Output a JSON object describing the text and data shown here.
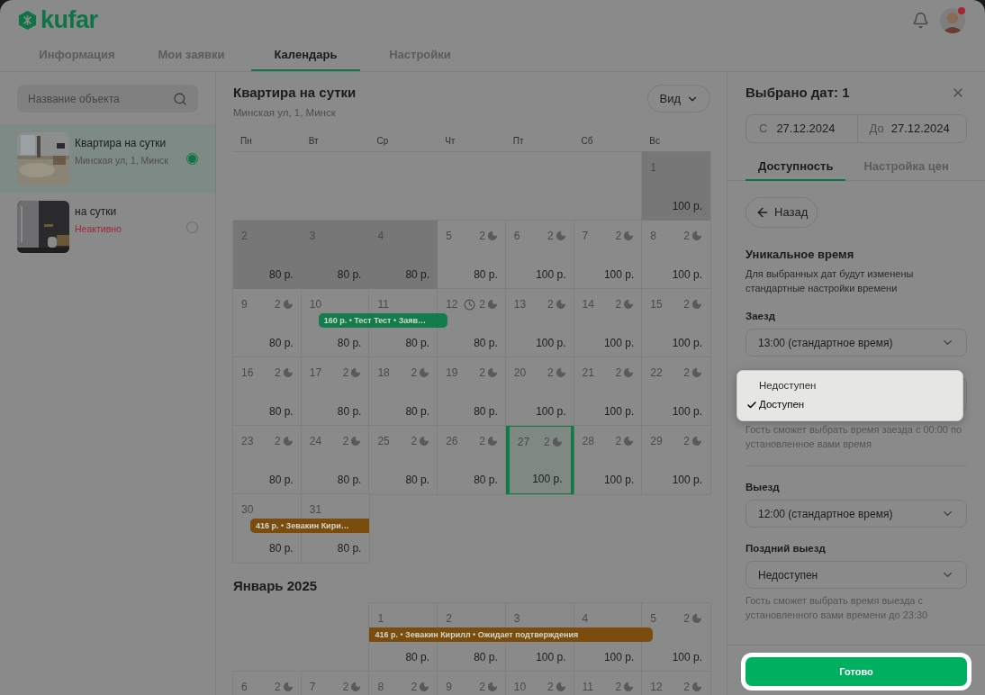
{
  "header": {
    "logo": "kufar",
    "tabs": [
      {
        "label": "Информация",
        "selected": false
      },
      {
        "label": "Мои заявки",
        "selected": false
      },
      {
        "label": "Календарь",
        "selected": true
      },
      {
        "label": "Настройки",
        "selected": false
      }
    ],
    "notification_dot": true
  },
  "sidebar": {
    "search": {
      "placeholder": "Название объекта"
    },
    "items": [
      {
        "title": "Квартира на сутки",
        "subtitle": "Минская ул, 1, Минск",
        "kind": "address",
        "selected": true
      },
      {
        "title": "на сутки",
        "subtitle": "Неактивно",
        "kind": "inactive",
        "selected": false
      }
    ]
  },
  "calendar": {
    "title": "Квартира на сутки",
    "address": "Минская ул, 1, Минск",
    "view_button": "Вид",
    "weekdays": [
      "Пн",
      "Вт",
      "Ср",
      "Чт",
      "Пт",
      "Сб",
      "Вс"
    ],
    "months": [
      {
        "weeks": [
          {
            "cells": [
              null,
              null,
              null,
              null,
              null,
              null,
              {
                "day": "1",
                "price": "100 р.",
                "unavailable": true,
                "selected": false
              }
            ]
          },
          {
            "cells": [
              {
                "day": "2",
                "price": "80 р.",
                "unavailable": true,
                "selected": false
              },
              {
                "day": "3",
                "price": "80 р.",
                "unavailable": true,
                "selected": false
              },
              {
                "day": "4",
                "price": "80 р.",
                "unavailable": true,
                "selected": false
              },
              {
                "day": "5",
                "nights": "2",
                "price": "80 р.",
                "unavailable": false,
                "selected": false
              },
              {
                "day": "6",
                "nights": "2",
                "price": "100 р.",
                "unavailable": false,
                "selected": false
              },
              {
                "day": "7",
                "nights": "2",
                "price": "100 р.",
                "unavailable": false,
                "selected": false
              },
              {
                "day": "8",
                "nights": "2",
                "price": "100 р.",
                "unavailable": false,
                "selected": false
              }
            ]
          },
          {
            "cells": [
              {
                "day": "9",
                "nights": "2",
                "price": "80 р.",
                "unavailable": false,
                "selected": false
              },
              {
                "day": "10",
                "price": "80 р.",
                "unavailable": false,
                "selected": false
              },
              {
                "day": "11",
                "price": "80 р.",
                "unavailable": false,
                "selected": false
              },
              {
                "day": "12",
                "clock": true,
                "nights": "2",
                "price": "80 р.",
                "unavailable": false,
                "selected": false
              },
              {
                "day": "13",
                "nights": "2",
                "price": "100 р.",
                "unavailable": false,
                "selected": false
              },
              {
                "day": "14",
                "nights": "2",
                "price": "100 р.",
                "unavailable": false,
                "selected": false
              },
              {
                "day": "15",
                "nights": "2",
                "price": "100 р.",
                "unavailable": false,
                "selected": false
              }
            ],
            "bookings": [
              {
                "text": "160 р. • Тест Тест • Заяв…",
                "color": "#137b4d",
                "continues_before": false,
                "continues_after": false
              }
            ]
          },
          {
            "cells": [
              {
                "day": "16",
                "nights": "2",
                "price": "80 р.",
                "unavailable": false,
                "selected": false
              },
              {
                "day": "17",
                "nights": "2",
                "price": "80 р.",
                "unavailable": false,
                "selected": false
              },
              {
                "day": "18",
                "nights": "2",
                "price": "80 р.",
                "unavailable": false,
                "selected": false
              },
              {
                "day": "19",
                "nights": "2",
                "price": "80 р.",
                "unavailable": false,
                "selected": false
              },
              {
                "day": "20",
                "nights": "2",
                "price": "100 р.",
                "unavailable": false,
                "selected": false
              },
              {
                "day": "21",
                "nights": "2",
                "price": "100 р.",
                "unavailable": false,
                "selected": false
              },
              {
                "day": "22",
                "nights": "2",
                "price": "100 р.",
                "unavailable": false,
                "selected": false
              }
            ]
          },
          {
            "cells": [
              {
                "day": "23",
                "nights": "2",
                "price": "80 р.",
                "unavailable": false,
                "selected": false
              },
              {
                "day": "24",
                "nights": "2",
                "price": "80 р.",
                "unavailable": false,
                "selected": false
              },
              {
                "day": "25",
                "nights": "2",
                "price": "80 р.",
                "unavailable": false,
                "selected": false
              },
              {
                "day": "26",
                "nights": "2",
                "price": "80 р.",
                "unavailable": false,
                "selected": false
              },
              {
                "day": "27",
                "nights": "2",
                "price": "100 р.",
                "unavailable": false,
                "selected": true
              },
              {
                "day": "28",
                "nights": "2",
                "price": "100 р.",
                "unavailable": false,
                "selected": false
              },
              {
                "day": "29",
                "nights": "2",
                "price": "100 р.",
                "unavailable": false,
                "selected": false
              }
            ]
          },
          {
            "cells": [
              {
                "day": "30",
                "price": "80 р.",
                "unavailable": false,
                "selected": false
              },
              {
                "day": "31",
                "price": "80 р.",
                "unavailable": false,
                "selected": false
              },
              null,
              null,
              null,
              null,
              null
            ],
            "bookings": [
              {
                "text": "416 р. • Зевакин Кири…",
                "color": "#7a4c0e",
                "continues_before": false,
                "continues_after": true
              }
            ]
          }
        ]
      },
      {
        "title": "Январь 2025",
        "weeks": [
          {
            "cells": [
              null,
              null,
              {
                "day": "1",
                "price": "80 р.",
                "unavailable": false,
                "selected": false
              },
              {
                "day": "2",
                "price": "80 р.",
                "unavailable": false,
                "selected": false
              },
              {
                "day": "3",
                "price": "100 р.",
                "unavailable": false,
                "selected": false
              },
              {
                "day": "4",
                "price": "100 р.",
                "unavailable": false,
                "selected": false
              },
              {
                "day": "5",
                "nights": "2",
                "price": "100 р.",
                "unavailable": false,
                "selected": false
              }
            ],
            "bookings": [
              {
                "text": "416 р. • Зевакин Кирилл • Ожидает подтверждения",
                "color": "#7a4c0e",
                "continues_before": true,
                "continues_after": false
              }
            ]
          },
          {
            "cells": [
              {
                "day": "6",
                "nights": "2",
                "unavailable": false,
                "selected": false
              },
              {
                "day": "7",
                "nights": "2",
                "unavailable": false,
                "selected": false
              },
              {
                "day": "8",
                "nights": "2",
                "unavailable": false,
                "selected": false
              },
              {
                "day": "9",
                "nights": "2",
                "unavailable": false,
                "selected": false
              },
              {
                "day": "10",
                "nights": "2",
                "unavailable": false,
                "selected": false
              },
              {
                "day": "11",
                "nights": "2",
                "unavailable": false,
                "selected": false
              },
              {
                "day": "12",
                "nights": "2",
                "unavailable": false,
                "selected": false
              }
            ]
          }
        ]
      }
    ]
  },
  "panel": {
    "title": "Выбрано дат: 1",
    "from_label": "С",
    "from_value": "27.12.2024",
    "to_label": "До",
    "to_value": "27.12.2024",
    "tabs": [
      {
        "label": "Доступность",
        "selected": true
      },
      {
        "label": "Настройка цен",
        "selected": false
      }
    ],
    "back_button": "Назад",
    "section_title": "Уникальное время",
    "section_text": "Для выбранных дат будут изменены стандартные настройки времени",
    "fields": [
      {
        "kind": "select",
        "label": "Заезд",
        "value": "13:00 (стандартное время)"
      },
      {
        "kind": "menu",
        "options": [
          {
            "label": "Недоступен",
            "selected": false
          },
          {
            "label": "Доступен",
            "selected": true
          }
        ],
        "hint": "Гость сможет выбрать время заезда с 00:00 по установленное вами время"
      },
      {
        "kind": "divider"
      },
      {
        "kind": "select",
        "label": "Выезд",
        "value": "12:00 (стандартное время)"
      },
      {
        "kind": "select",
        "label": "Поздний выезд",
        "value": "Недоступен",
        "hint": "Гость сможет выбрать время выезда с установленного вами времени до 23:30"
      }
    ],
    "done_button": "Готово"
  }
}
